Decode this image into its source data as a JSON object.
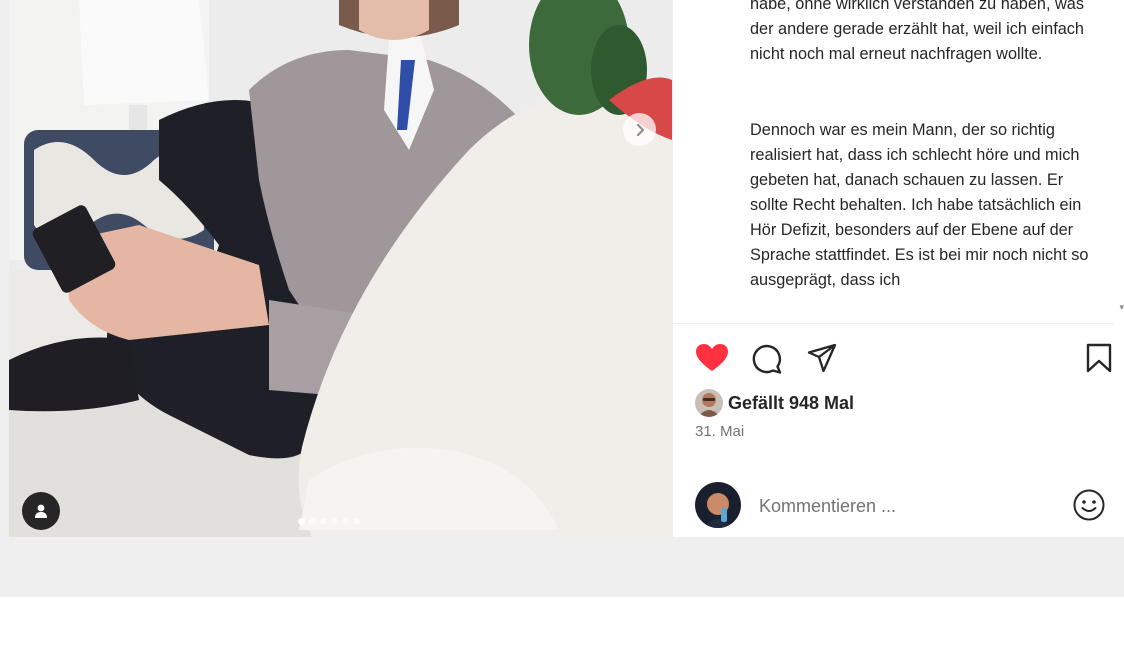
{
  "media": {
    "carousel": {
      "count": 6,
      "active_index": 0
    }
  },
  "caption": {
    "paragraph1": "habe, ohne wirklich verstanden zu haben, was der andere gerade erzählt hat, weil ich einfach nicht noch mal erneut nachfragen wollte.",
    "paragraph2": "Dennoch war es mein Mann, der so richtig realisiert hat, dass ich schlecht höre und mich gebeten hat, danach schauen zu lassen. Er sollte Recht behalten. Ich habe tatsächlich ein Hör Defizit, besonders auf der Ebene auf der Sprache stattfindet. Es ist bei mir noch nicht so ausgeprägt, dass ich"
  },
  "actions": {
    "like_icon": "heart-filled-icon",
    "comment_icon": "comment-icon",
    "share_icon": "paper-plane-icon",
    "save_icon": "bookmark-icon"
  },
  "likes": {
    "text": "Gefällt 948 Mal"
  },
  "post_date": "31. Mai",
  "comment": {
    "placeholder": "Kommentieren ...",
    "value": ""
  },
  "colors": {
    "like_red": "#ff3040",
    "text": "#262626",
    "muted": "#737373",
    "backdrop": "#efefef"
  }
}
